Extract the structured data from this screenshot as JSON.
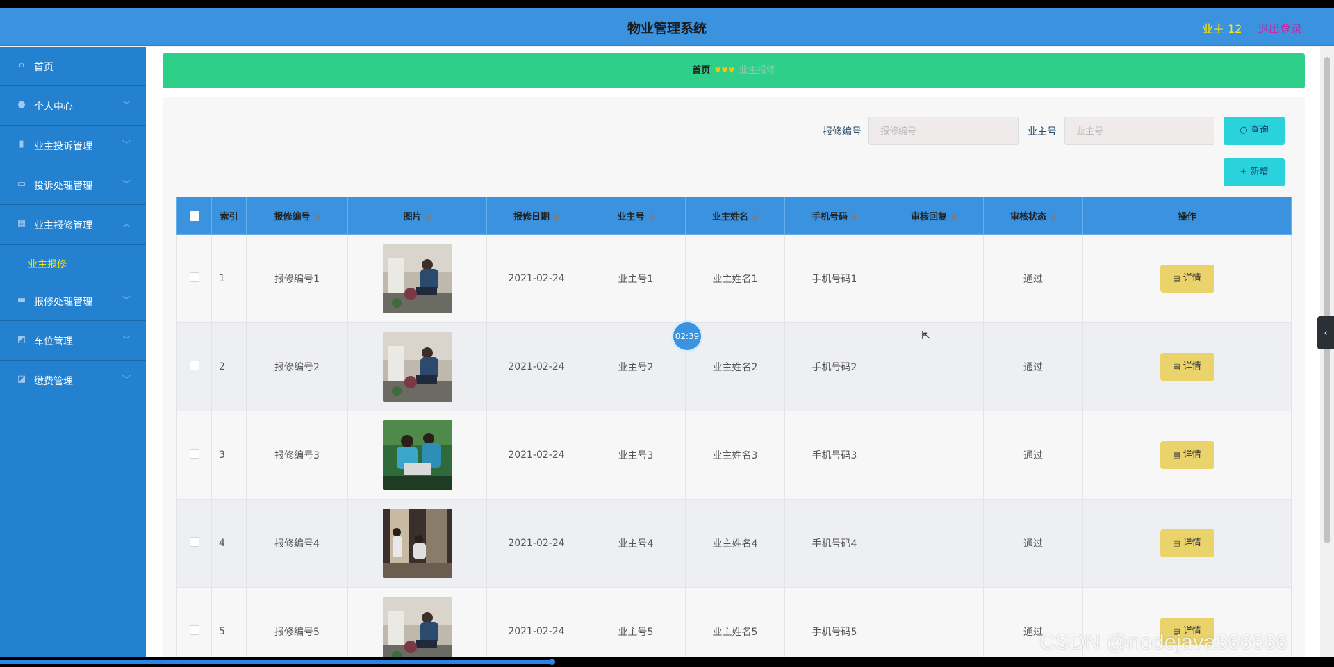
{
  "header": {
    "title": "物业管理系统",
    "user_label": "业主 12",
    "logout_label": "退出登录"
  },
  "sidebar": {
    "items": [
      {
        "label": "首页",
        "icon": "home-icon",
        "chevron": ""
      },
      {
        "label": "个人中心",
        "icon": "user-icon",
        "chevron": "﹀"
      },
      {
        "label": "业主投诉管理",
        "icon": "chart-bar-icon",
        "chevron": "﹀"
      },
      {
        "label": "投诉处理管理",
        "icon": "message-icon",
        "chevron": "﹀"
      },
      {
        "label": "业主报修管理",
        "icon": "grid-icon",
        "chevron": "︿"
      },
      {
        "label": "报修处理管理",
        "icon": "monitor-icon",
        "chevron": "﹀"
      },
      {
        "label": "车位管理",
        "icon": "chart-icon",
        "chevron": "﹀"
      },
      {
        "label": "缴费管理",
        "icon": "wallet-icon",
        "chevron": "﹀"
      }
    ],
    "submenu": {
      "label": "业主报修"
    }
  },
  "breadcrumb": {
    "home": "首页",
    "separator": "♥♥♥",
    "current": "业主报修"
  },
  "search": {
    "repair_no_label": "报修编号",
    "repair_no_placeholder": "报修编号",
    "owner_no_label": "业主号",
    "owner_no_placeholder": "业主号",
    "query_label": "查询",
    "add_label": "新增"
  },
  "table": {
    "columns": [
      "索引",
      "报修编号",
      "图片",
      "报修日期",
      "业主号",
      "业主姓名",
      "手机号码",
      "审核回复",
      "审核状态",
      "操作"
    ],
    "detail_label": "详情",
    "rows": [
      {
        "index": "1",
        "repair_no": "报修编号1",
        "image": "photo-plumber-sink",
        "date": "2021-02-24",
        "owner_no": "业主号1",
        "owner_name": "业主姓名1",
        "phone": "手机号码1",
        "reply": "",
        "status": "通过"
      },
      {
        "index": "2",
        "repair_no": "报修编号2",
        "image": "photo-plumber-sink",
        "date": "2021-02-24",
        "owner_no": "业主号2",
        "owner_name": "业主姓名2",
        "phone": "手机号码2",
        "reply": "",
        "status": "通过"
      },
      {
        "index": "3",
        "repair_no": "报修编号3",
        "image": "photo-workers-green",
        "date": "2021-02-24",
        "owner_no": "业主号3",
        "owner_name": "业主姓名3",
        "phone": "手机号码3",
        "reply": "",
        "status": "通过"
      },
      {
        "index": "4",
        "repair_no": "报修编号4",
        "image": "photo-doorway-repair",
        "date": "2021-02-24",
        "owner_no": "业主号4",
        "owner_name": "业主姓名4",
        "phone": "手机号码4",
        "reply": "",
        "status": "通过"
      },
      {
        "index": "5",
        "repair_no": "报修编号5",
        "image": "photo-plumber-sink",
        "date": "2021-02-24",
        "owner_no": "业主号5",
        "owner_name": "业主姓名5",
        "phone": "手机号码5",
        "reply": "",
        "status": "通过"
      }
    ]
  },
  "overlay": {
    "timer": "02:39",
    "watermark": "CSDN @nodejava666666",
    "video_progress": 0.414
  },
  "colors": {
    "header": "#3b93e0",
    "sidebar": "#2481cf",
    "breadcrumb": "#2ecf89",
    "accent_yellow": "#ffe600",
    "logout": "#e0179c",
    "button_cyan": "#2ad3dc",
    "button_detail": "#e9d36a"
  }
}
